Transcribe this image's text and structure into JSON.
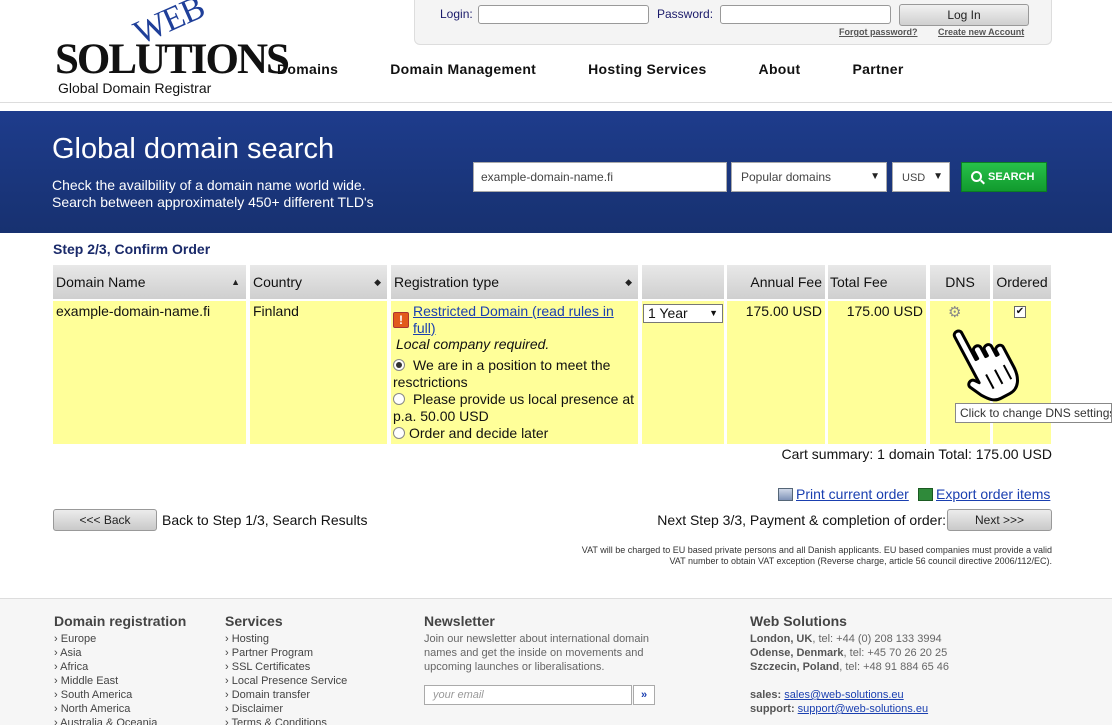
{
  "header": {
    "logo": {
      "web": "WEB",
      "solutions": "SOLUTIONS",
      "tagline": "Global Domain Registrar"
    },
    "login": {
      "login_label": "Login:",
      "password_label": "Password:",
      "button": "Log In",
      "forgot": "Forgot password?",
      "create": "Create new Account"
    },
    "nav": [
      "Domains",
      "Domain Management",
      "Hosting Services",
      "About",
      "Partner"
    ]
  },
  "hero": {
    "title": "Global domain search",
    "line1": "Check the availbility of a domain name world wide.",
    "line2": "Search between approximately 450+ different TLD's",
    "search_value": "example-domain-name.fi",
    "domains_select": "Popular domains",
    "currency_select": "USD",
    "search_button": "SEARCH"
  },
  "order": {
    "step_title": "Step 2/3, Confirm Order",
    "columns": [
      "Domain Name",
      "Country",
      "Registration type",
      "",
      "Annual Fee",
      "Total Fee",
      "DNS",
      "Ordered"
    ],
    "row": {
      "domain": "example-domain-name.fi",
      "country": "Finland",
      "restricted_link_1": "Restricted Domain (read rules in",
      "restricted_link_2": "full)",
      "local_required": "Local company required.",
      "option1_a": "We are in a position to meet the",
      "option1_b": "resctrictions",
      "option2_a": "Please provide us local presence at",
      "option2_b": "p.a. 50.00 USD",
      "option3": "Order and decide later",
      "period": "1 Year",
      "annual_fee": "175.00 USD",
      "total_fee": "175.00 USD",
      "ordered": true
    },
    "tooltip": "Click to change DNS settings",
    "summary": "Cart summary: 1 domain Total: 175.00 USD",
    "print": "Print current order",
    "export": "Export order items",
    "back_button": "<<< Back",
    "back_text": "Back to Step 1/3, Search Results",
    "next_text": "Next Step 3/3, Payment & completion of order:",
    "next_button": "Next >>>",
    "vat_1": "VAT will be charged to EU based private persons and all Danish applicants. EU based companies must provide a valid",
    "vat_2": "VAT number to obtain VAT exception (Reverse charge, article 56 council directive 2006/112/EC)."
  },
  "footer": {
    "domain_registration": {
      "title": "Domain registration",
      "items": [
        "Europe",
        "Asia",
        "Africa",
        "Middle East",
        "South America",
        "North America",
        "Australia & Oceania"
      ]
    },
    "services": {
      "title": "Services",
      "items": [
        "Hosting",
        "Partner Program",
        "SSL Certificates",
        "Local Presence Service",
        "Domain transfer",
        "Disclaimer",
        "Terms & Conditions"
      ]
    },
    "newsletter": {
      "title": "Newsletter",
      "text1": "Join our newsletter about international domain",
      "text2": "names and get the inside on movements and",
      "text3": "upcoming launches or liberalisations.",
      "placeholder": "your email",
      "go": "»"
    },
    "web_solutions": {
      "title": "Web Solutions",
      "l1_city": "London, UK",
      "l1_tel": ", tel: +44 (0) 208 133 3994",
      "l2_city": "Odense, Denmark",
      "l2_tel": ", tel: +45 70 26 20 25",
      "l3_city": "Szczecin, Poland",
      "l3_tel": ", tel: +48 91 884 65 46",
      "sales_label": "sales:",
      "sales_email": "sales@web-solutions.eu",
      "support_label": "support:",
      "support_email": "support@web-solutions.eu"
    }
  }
}
